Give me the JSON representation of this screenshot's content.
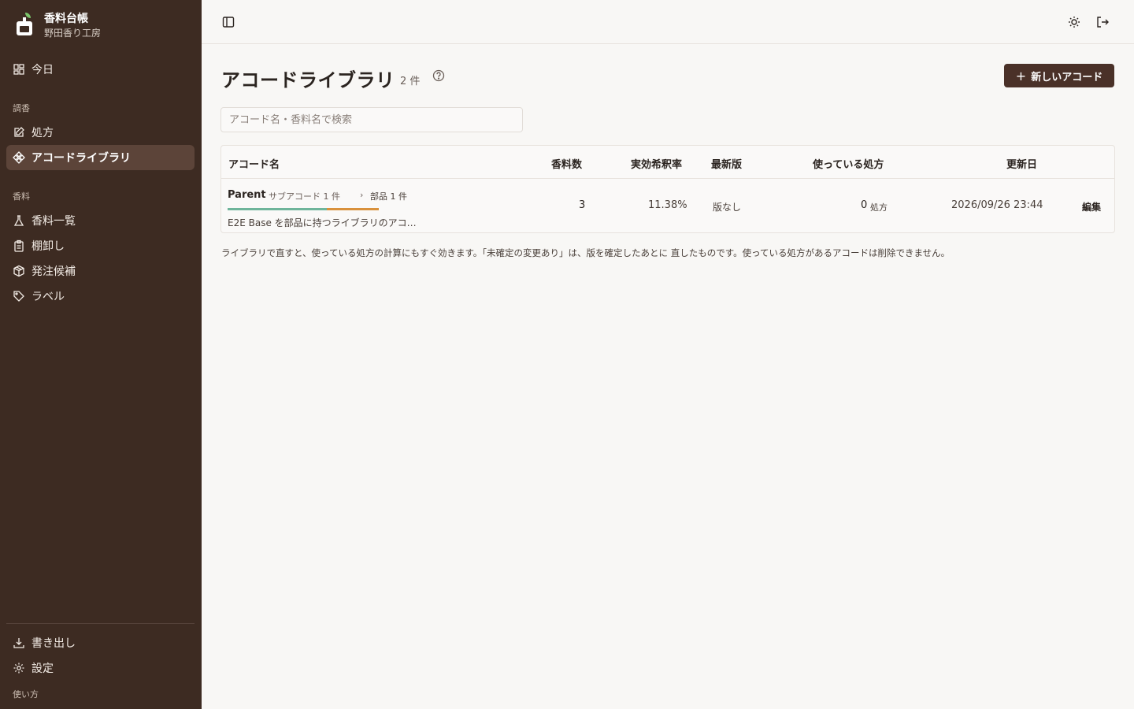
{
  "app": {
    "title": "香料台帳",
    "subtitle": "野田香り工房"
  },
  "sidebar": {
    "today": "今日",
    "sections": [
      {
        "label": "調香",
        "items": [
          {
            "label": "処方",
            "icon": "edit-icon"
          },
          {
            "label": "アコードライブラリ",
            "icon": "diamond-icon",
            "active": true
          }
        ]
      },
      {
        "label": "香料",
        "items": [
          {
            "label": "香料一覧",
            "icon": "flask-icon"
          },
          {
            "label": "棚卸し",
            "icon": "clipboard-icon"
          },
          {
            "label": "発注候補",
            "icon": "package-icon"
          },
          {
            "label": "ラベル",
            "icon": "tag-icon"
          }
        ]
      }
    ],
    "footer": {
      "export": "書き出し",
      "settings": "設定",
      "help": "使い方"
    }
  },
  "header": {
    "title": "アコードライブラリ",
    "count": "2 件",
    "new_button": "新しいアコード"
  },
  "search": {
    "placeholder": "アコード名・香料名で検索"
  },
  "table": {
    "columns": [
      "アコード名",
      "香料数",
      "実効希釈率",
      "最新版",
      "使っている処方",
      "更新日"
    ],
    "rows": [
      {
        "name": "Parent",
        "sub_accords": "サブアコード 1 件",
        "parts": "部品 1 件",
        "description": "E2E Base を部品に持つライブラリのアコ…",
        "ingredient_count": "3",
        "effective_dilution": "11.38%",
        "latest_version": "版なし",
        "used_in_count": "0",
        "used_in_unit": "処方",
        "updated": "2026/09/26 23:44",
        "edit": "編集"
      }
    ]
  },
  "footnote": "ライブラリで直すと、使っている処方の計算にもすぐ効きます。「未確定の変更あり」は、版を確定したあとに 直したものです。使っている処方があるアコードは削除できません。",
  "colors": {
    "sidebar": "#3d2b22",
    "accent": "#4a3128",
    "bar_green": "#6fb59b",
    "bar_orange": "#d9913c"
  }
}
